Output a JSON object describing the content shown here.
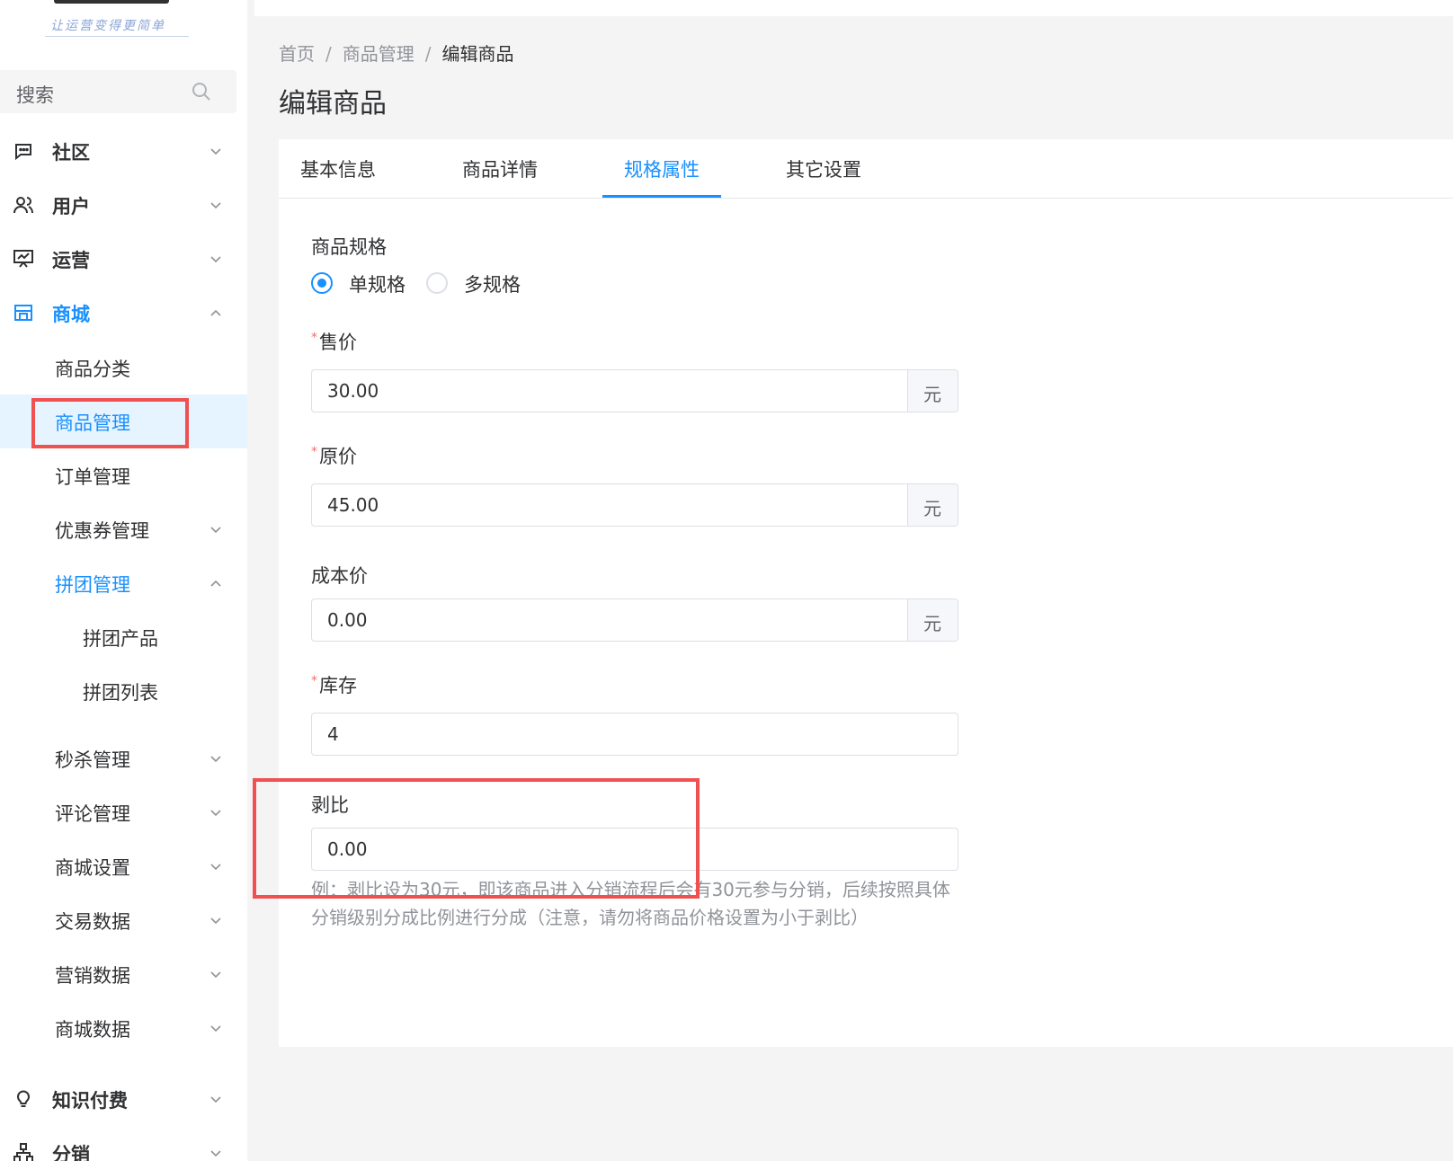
{
  "sidebar": {
    "logo_slogan": "让运营变得更简单",
    "search_placeholder": "搜索",
    "groups": {
      "community": "社区",
      "users": "用户",
      "operations": "运营",
      "mall": "商城",
      "knowledge": "知识付费",
      "distribution": "分销"
    },
    "mall_items": {
      "category": "商品分类",
      "product_manage": "商品管理",
      "order_manage": "订单管理",
      "coupon_manage": "优惠券管理",
      "group_buy_manage": "拼团管理",
      "group_buy_product": "拼团产品",
      "group_buy_list": "拼团列表",
      "flash_sale": "秒杀管理",
      "comment_manage": "评论管理",
      "mall_settings": "商城设置",
      "trade_data": "交易数据",
      "marketing_data": "营销数据",
      "mall_data": "商城数据"
    }
  },
  "breadcrumb": {
    "home": "首页",
    "product_manage": "商品管理",
    "current": "编辑商品",
    "separator": "/"
  },
  "page_title": "编辑商品",
  "tabs": {
    "basic": "基本信息",
    "detail": "商品详情",
    "spec": "规格属性",
    "other": "其它设置"
  },
  "form": {
    "spec_label": "商品规格",
    "single_spec": "单规格",
    "multi_spec": "多规格",
    "required_mark": "*",
    "price_label": "售价",
    "price_value": "30.00",
    "original_price_label": "原价",
    "original_price_value": "45.00",
    "cost_price_label": "成本价",
    "cost_price_value": "0.00",
    "stock_label": "库存",
    "stock_value": "4",
    "commission_label": "剥比",
    "commission_value": "0.00",
    "currency_suffix": "元",
    "commission_hint": "例：剥比设为30元，即该商品进入分销流程后会有30元参与分销，后续按照具体分销级别分成比例进行分成（注意，请勿将商品价格设置为小于剥比）"
  },
  "colors": {
    "accent": "#1890ff",
    "highlight_box": "#f05050",
    "required": "#f56c6c"
  }
}
